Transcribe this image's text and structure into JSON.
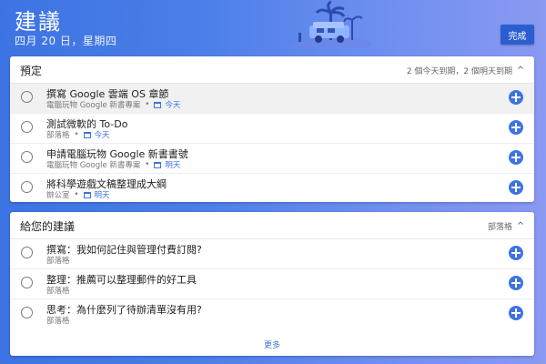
{
  "header": {
    "title": "建議",
    "date": "四月 20 日，星期四",
    "done_label": "完成"
  },
  "scheduled": {
    "title": "預定",
    "meta": "2 個今天到期，2 個明天到期",
    "items": [
      {
        "title": "撰寫 Google 雲端 OS 章節",
        "source": "電腦玩物 Google 新書專案",
        "due": "今天"
      },
      {
        "title": "測試微軟的 To-Do",
        "source": "部落格",
        "due": "今天"
      },
      {
        "title": "申請電腦玩物 Google 新書書號",
        "source": "電腦玩物 Google 新書專案",
        "due": "明天"
      },
      {
        "title": "將科學遊戲文稿整理成大綱",
        "source": "辦公室",
        "due": "明天"
      }
    ]
  },
  "suggestions": {
    "title": "給您的建議",
    "meta": "部落格",
    "items": [
      {
        "title": "撰寫：我如何記住與管理付費訂閱?",
        "source": "部落格"
      },
      {
        "title": "整理：推薦可以整理郵件的好工具",
        "source": "部落格"
      },
      {
        "title": "思考：為什麼列了待辦清單沒有用?",
        "source": "部落格"
      }
    ],
    "more_label": "更多"
  },
  "colors": {
    "accent": "#3d74e3",
    "done_button": "#2b5fcf"
  }
}
